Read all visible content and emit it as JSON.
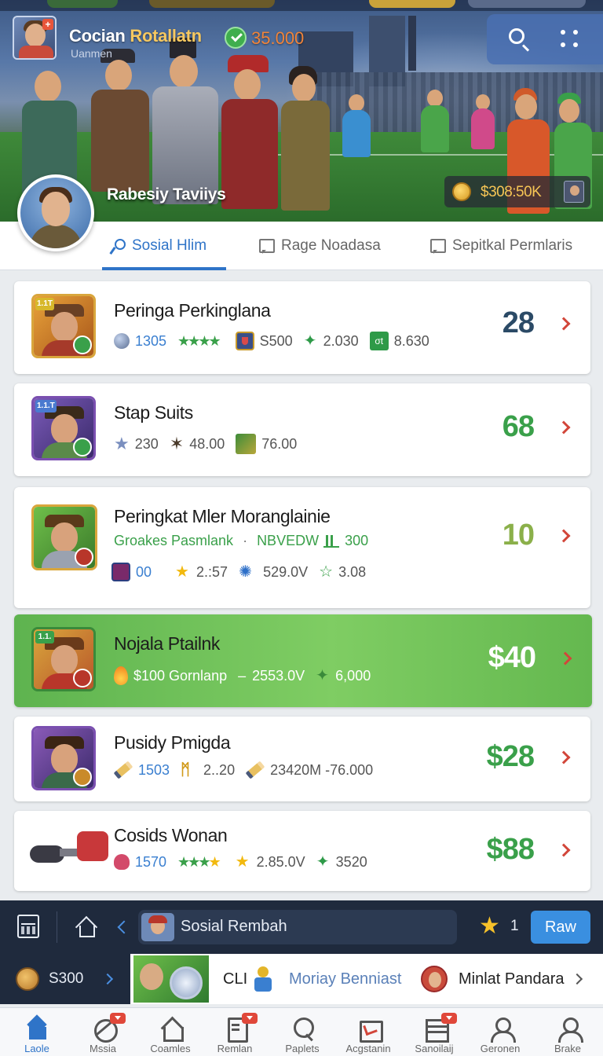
{
  "header": {
    "title_part1": "Cocian",
    "title_part2": "Rotallatn",
    "subtitle": "Uanmen",
    "coins": "35.000",
    "player_name": "Rabesiy Taviiys",
    "balance": "$308:50K"
  },
  "tabs": [
    {
      "label": "Sosial Hlim",
      "active": true
    },
    {
      "label": "Rage Noadasa",
      "active": false
    },
    {
      "label": "Sepitkal Permlaris",
      "active": false
    }
  ],
  "list": [
    {
      "title": "Peringa Perkinglana",
      "tag": "1.1T",
      "score": "28",
      "score_color": "#2b4a66",
      "stats": {
        "a": "1305",
        "b": "S500",
        "c": "2.030",
        "d": "8.630"
      }
    },
    {
      "title": "Stap Suits",
      "tag": "1.1.T",
      "score": "68",
      "score_color": "#3aa04a",
      "stats": {
        "a": "230",
        "b": "48.00",
        "c": "76.00"
      }
    },
    {
      "title": "Peringkat Mler Moranglainie",
      "score": "10",
      "score_color": "#8bb04a",
      "line1": {
        "a": "Groakes Pasmlank",
        "sep": "·",
        "b": "NBVEDW",
        "c": "300"
      },
      "line2": {
        "a": "00",
        "b": "2.:57",
        "c": "529.0V",
        "d": "3.08"
      }
    },
    {
      "title": "Nojala Ptailnk",
      "tag": "1.1.",
      "score": "$40",
      "score_color": "#ffffff",
      "stats": {
        "a": "$100 Gornlanp",
        "dash": "–",
        "b": "2553.0V",
        "c": "6,000"
      }
    },
    {
      "title": "Pusidy Pmigda",
      "score": "$28",
      "score_color": "#3aa04a",
      "stats": {
        "a": "1503",
        "b": "2..20",
        "c": "23420M -76.000"
      }
    },
    {
      "title": "Cosids Wonan",
      "score": "$88",
      "score_color": "#3aa04a",
      "stats": {
        "a": "1570",
        "b": "2.85.0V",
        "c": "3520"
      }
    }
  ],
  "bottom_bar": {
    "search_text": "Sosial Rembah",
    "star_count": "1",
    "raw_label": "Raw"
  },
  "promo": {
    "coins": "S300",
    "cli": "CLI",
    "link": "Moriay Benniast",
    "name": "Minlat Pandara"
  },
  "nav": [
    {
      "label": "Laole",
      "icon": "home-icon"
    },
    {
      "label": "Mssia",
      "icon": "compass-icon"
    },
    {
      "label": "Coamles",
      "icon": "house-icon"
    },
    {
      "label": "Remlan",
      "icon": "document-icon"
    },
    {
      "label": "Paplets",
      "icon": "search-icon"
    },
    {
      "label": "Acgstanin",
      "icon": "card-icon"
    },
    {
      "label": "Sanoilaij",
      "icon": "grid-icon"
    },
    {
      "label": "Geronen",
      "icon": "user-icon"
    },
    {
      "label": "Brake",
      "icon": "user-icon"
    }
  ]
}
